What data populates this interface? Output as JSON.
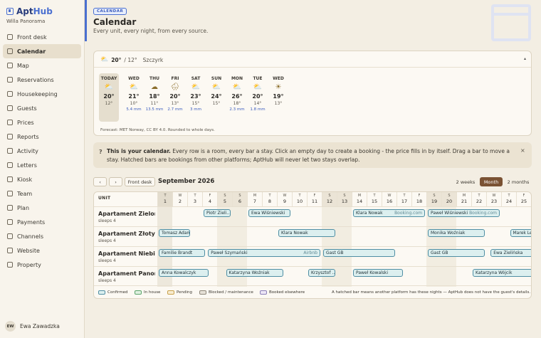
{
  "brand": {
    "name_a": "Apt",
    "name_b": "Hub",
    "property": "Willa Panorama"
  },
  "nav": [
    {
      "label": "Front desk",
      "icon": "front-desk-icon",
      "active": false
    },
    {
      "label": "Calendar",
      "icon": "calendar-icon",
      "active": true
    },
    {
      "label": "Map",
      "icon": "map-icon",
      "active": false
    },
    {
      "label": "Reservations",
      "icon": "reservations-icon",
      "active": false
    },
    {
      "label": "Housekeeping",
      "icon": "housekeeping-icon",
      "active": false
    },
    {
      "label": "Guests",
      "icon": "guests-icon",
      "active": false
    },
    {
      "label": "Prices",
      "icon": "prices-icon",
      "active": false
    },
    {
      "label": "Reports",
      "icon": "reports-icon",
      "active": false
    },
    {
      "label": "Activity",
      "icon": "activity-icon",
      "active": false
    },
    {
      "label": "Letters",
      "icon": "letters-icon",
      "active": false
    },
    {
      "label": "Kiosk",
      "icon": "kiosk-icon",
      "active": false
    },
    {
      "label": "Team",
      "icon": "team-icon",
      "active": false
    },
    {
      "label": "Plan",
      "icon": "plan-icon",
      "active": false
    },
    {
      "label": "Payments",
      "icon": "payments-icon",
      "active": false
    },
    {
      "label": "Channels",
      "icon": "channels-icon",
      "active": false
    },
    {
      "label": "Website",
      "icon": "website-icon",
      "active": false
    },
    {
      "label": "Property",
      "icon": "property-icon",
      "active": false
    }
  ],
  "user": {
    "initials": "EW",
    "name": "Ewa Zawadzka"
  },
  "page": {
    "badge": "CALENDAR",
    "title": "Calendar",
    "subtitle": "Every unit, every night, from every source."
  },
  "forecast": {
    "current_temp": "20°",
    "current_low": "/ 12°",
    "location": "Szczyrk",
    "collapse_glyph": "▴",
    "days": [
      {
        "name": "TODAY",
        "icon": "⛅",
        "hi": "20°",
        "lo": "12°",
        "rain": ""
      },
      {
        "name": "WED",
        "icon": "⛅",
        "hi": "21°",
        "lo": "10°",
        "rain": "5.4 mm"
      },
      {
        "name": "THU",
        "icon": "☁",
        "hi": "18°",
        "lo": "11°",
        "rain": "13.5 mm"
      },
      {
        "name": "FRI",
        "icon": "🌧",
        "hi": "20°",
        "lo": "13°",
        "rain": "2.7 mm"
      },
      {
        "name": "SAT",
        "icon": "⛅",
        "hi": "23°",
        "lo": "15°",
        "rain": "3 mm"
      },
      {
        "name": "SUN",
        "icon": "⛅",
        "hi": "24°",
        "lo": "15°",
        "rain": ""
      },
      {
        "name": "MON",
        "icon": "⛅",
        "hi": "26°",
        "lo": "18°",
        "rain": "2.3 mm"
      },
      {
        "name": "TUE",
        "icon": "⛅",
        "hi": "20°",
        "lo": "14°",
        "rain": "1.8 mm"
      },
      {
        "name": "WED",
        "icon": "☀",
        "hi": "19°",
        "lo": "13°",
        "rain": ""
      }
    ],
    "note": "Forecast: MET Norway, CC BY 4.0. Rounded to whole days."
  },
  "hint": {
    "q": "?",
    "title": "This is your calendar.",
    "text": " Every row is a room, every bar a stay. Click an empty day to create a booking - the price fills in by itself. Drag a bar to move a stay. Hatched bars are bookings from other platforms; AptHub will never let two stays overlap.",
    "close": "×"
  },
  "toolbar": {
    "prev": "‹",
    "next": "›",
    "front_desk": "Front desk",
    "month": "September 2026",
    "view_2w": "2 weeks",
    "view_month": "Month",
    "view_2m": "2 months"
  },
  "grid": {
    "unit_header": "UNIT",
    "days": [
      {
        "w": "T",
        "d": "1",
        "type": "today"
      },
      {
        "w": "W",
        "d": "2",
        "type": ""
      },
      {
        "w": "T",
        "d": "3",
        "type": ""
      },
      {
        "w": "F",
        "d": "4",
        "type": ""
      },
      {
        "w": "S",
        "d": "5",
        "type": "wk"
      },
      {
        "w": "S",
        "d": "6",
        "type": "wk"
      },
      {
        "w": "M",
        "d": "7",
        "type": ""
      },
      {
        "w": "T",
        "d": "8",
        "type": ""
      },
      {
        "w": "W",
        "d": "9",
        "type": ""
      },
      {
        "w": "T",
        "d": "10",
        "type": ""
      },
      {
        "w": "F",
        "d": "11",
        "type": ""
      },
      {
        "w": "S",
        "d": "12",
        "type": "wk"
      },
      {
        "w": "S",
        "d": "13",
        "type": "wk"
      },
      {
        "w": "M",
        "d": "14",
        "type": ""
      },
      {
        "w": "T",
        "d": "15",
        "type": ""
      },
      {
        "w": "W",
        "d": "16",
        "type": ""
      },
      {
        "w": "T",
        "d": "17",
        "type": ""
      },
      {
        "w": "F",
        "d": "18",
        "type": ""
      },
      {
        "w": "S",
        "d": "19",
        "type": "wk"
      },
      {
        "w": "S",
        "d": "20",
        "type": "wk"
      },
      {
        "w": "M",
        "d": "21",
        "type": ""
      },
      {
        "w": "T",
        "d": "22",
        "type": ""
      },
      {
        "w": "W",
        "d": "23",
        "type": ""
      },
      {
        "w": "T",
        "d": "24",
        "type": ""
      },
      {
        "w": "F",
        "d": "25",
        "type": ""
      }
    ],
    "units": [
      {
        "name": "Apartament Zielony",
        "sleeps": "sleeps 4",
        "bars": [
          {
            "label": "Piotr Zieli…",
            "src": "",
            "start": 3,
            "end": 5
          },
          {
            "label": "Ewa Wiśniewski",
            "src": "",
            "start": 6,
            "end": 9
          },
          {
            "label": "Klara Nowak",
            "src": "Booking.com",
            "start": 13,
            "end": 18
          },
          {
            "label": "Paweł Wiśniewski",
            "src": "Booking.com",
            "start": 18,
            "end": 23
          }
        ]
      },
      {
        "name": "Apartament Złoty",
        "sleeps": "sleeps 4",
        "bars": [
          {
            "label": "Tomasz Adam…",
            "src": "",
            "start": 0,
            "end": 2.3
          },
          {
            "label": "Klara Nowak",
            "src": "",
            "start": 8,
            "end": 12
          },
          {
            "label": "Monika Woźniak",
            "src": "",
            "start": 18,
            "end": 22
          },
          {
            "label": "Marek Lew…",
            "src": "",
            "start": 23.5,
            "end": 26
          }
        ]
      },
      {
        "name": "Apartament Niebieski",
        "sleeps": "sleeps 4",
        "bars": [
          {
            "label": "Familie Brandt",
            "src": "",
            "start": 0,
            "end": 3.3
          },
          {
            "label": "Paweł Szymański",
            "src": "Airbnb",
            "start": 3.3,
            "end": 11
          },
          {
            "label": "Gast GB",
            "src": "",
            "start": 11,
            "end": 16
          },
          {
            "label": "Gast GB",
            "src": "",
            "start": 18,
            "end": 22
          },
          {
            "label": "Ewa Zielińska",
            "src": "",
            "start": 22.2,
            "end": 26
          }
        ]
      },
      {
        "name": "Apartament Panora…",
        "sleeps": "sleeps 4",
        "bars": [
          {
            "label": "Anna Kowalczyk",
            "src": "",
            "start": 0,
            "end": 3.5
          },
          {
            "label": "Katarzyna Woźniak",
            "src": "",
            "start": 4.5,
            "end": 8.5
          },
          {
            "label": "Krzysztof …",
            "src": "",
            "start": 10,
            "end": 12
          },
          {
            "label": "Paweł Kowalski",
            "src": "",
            "start": 13,
            "end": 16.5
          },
          {
            "label": "Katarzyna Wójcik",
            "src": "",
            "start": 21,
            "end": 26
          }
        ]
      }
    ],
    "legend": [
      {
        "label": "Confirmed",
        "fill": "#dcefef",
        "border": "#4f8ea3"
      },
      {
        "label": "In house",
        "fill": "#dff0e0",
        "border": "#5aa36a"
      },
      {
        "label": "Pending",
        "fill": "#f8ecd0",
        "border": "#c7a04a"
      },
      {
        "label": "Blocked / maintenance",
        "fill": "#e6e1d7",
        "border": "#8e877a"
      },
      {
        "label": "Booked elsewhere",
        "fill": "#ece6f5",
        "border": "#8b7fb8"
      }
    ],
    "legend_note": "A hatched bar means another platform has these nights — AptHub does not have the guest's details."
  }
}
